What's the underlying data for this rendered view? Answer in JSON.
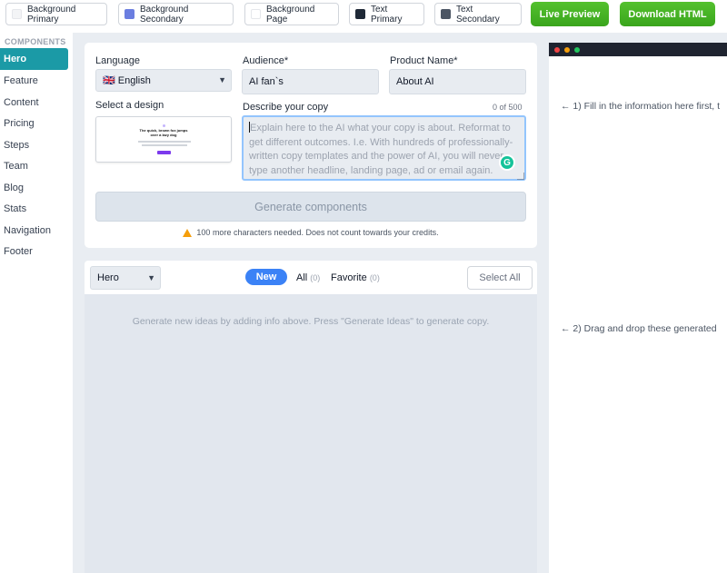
{
  "toolbar": {
    "swatches": [
      {
        "label": "Background Primary",
        "color": "#f3f4f6"
      },
      {
        "label": "Background Secondary",
        "color": "#6b7ee0"
      },
      {
        "label": "Background Page",
        "color": "#ffffff"
      },
      {
        "label": "Text Primary",
        "color": "#1f2937"
      },
      {
        "label": "Text Secondary",
        "color": "#4b5563"
      }
    ],
    "live_preview": "Live Preview",
    "download_html": "Download HTML"
  },
  "sidebar": {
    "heading": "COMPONENTS",
    "items": [
      "Hero",
      "Feature",
      "Content",
      "Pricing",
      "Steps",
      "Team",
      "Blog",
      "Stats",
      "Navigation",
      "Footer"
    ],
    "active": "Hero"
  },
  "form": {
    "language_label": "Language",
    "language_value": "🇬🇧 English",
    "audience_label": "Audience*",
    "audience_value": "AI fan`s",
    "product_label": "Product Name*",
    "product_value": "About AI",
    "design_label": "Select a design",
    "design_thumb_title_1": "The quick, brown fox jumps",
    "design_thumb_title_2": "over a lazy dog",
    "describe_label": "Describe your copy",
    "char_count": "0 of 500",
    "describe_placeholder": "Explain here to the AI what your copy is about. Reformat to get different outcomes. I.e. With hundreds of professionally-written copy templates and the power of AI, you will never type another headline, landing page, ad or email again.",
    "grammarly_letter": "G",
    "generate_button": "Generate components",
    "warning": "100 more characters needed. Does not count towards your credits."
  },
  "results": {
    "component_select": "Hero",
    "tab_new": "New",
    "tab_all": "All",
    "tab_all_count": "(0)",
    "tab_favorite": "Favorite",
    "tab_favorite_count": "(0)",
    "select_all": "Select All",
    "empty_message": "Generate new ideas by adding info above. Press \"Generate Ideas\" to generate copy."
  },
  "preview": {
    "hint_1": "← 1) Fill in the information here first, t",
    "hint_2": "← 2) Drag and drop these generated"
  }
}
